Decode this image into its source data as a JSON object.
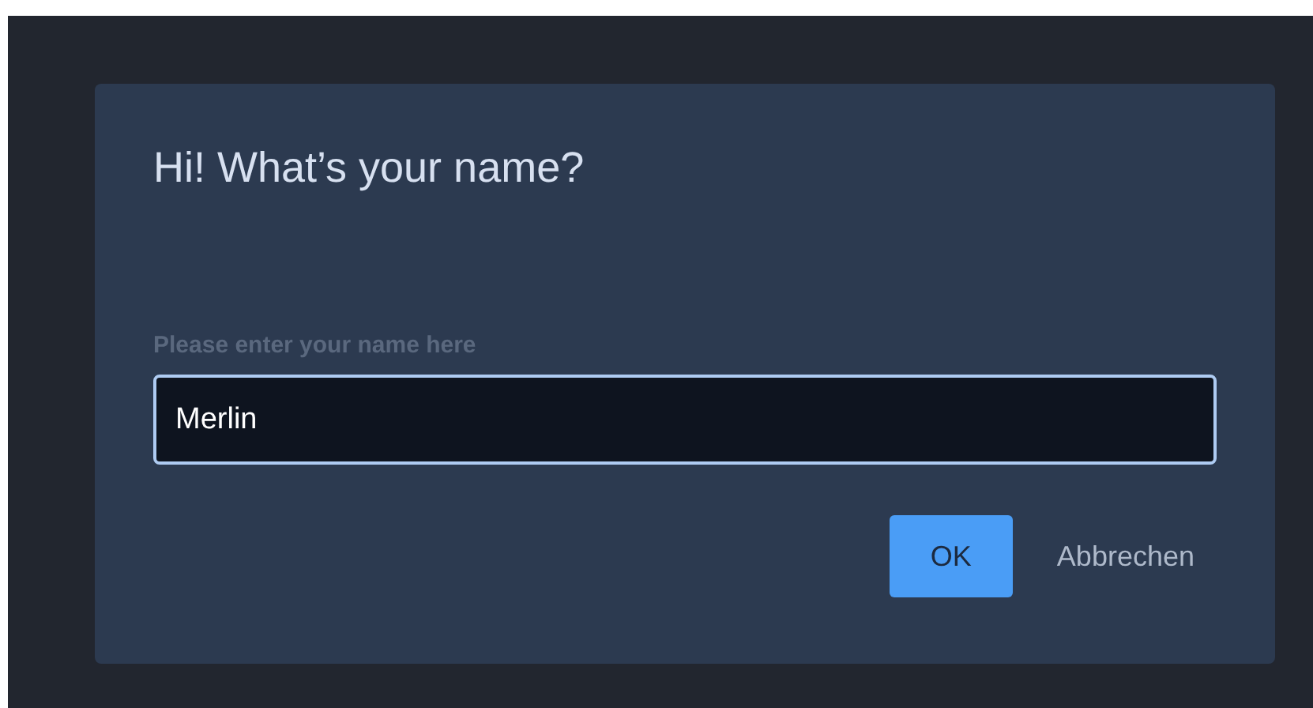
{
  "dialog": {
    "title": "Hi! What’s your name?",
    "field": {
      "label": "Please enter your name here",
      "value": "Merlin",
      "focused": true
    },
    "buttons": [
      {
        "label": "OK",
        "kind": "primary"
      },
      {
        "label": "Abbrechen",
        "kind": "text"
      }
    ]
  }
}
